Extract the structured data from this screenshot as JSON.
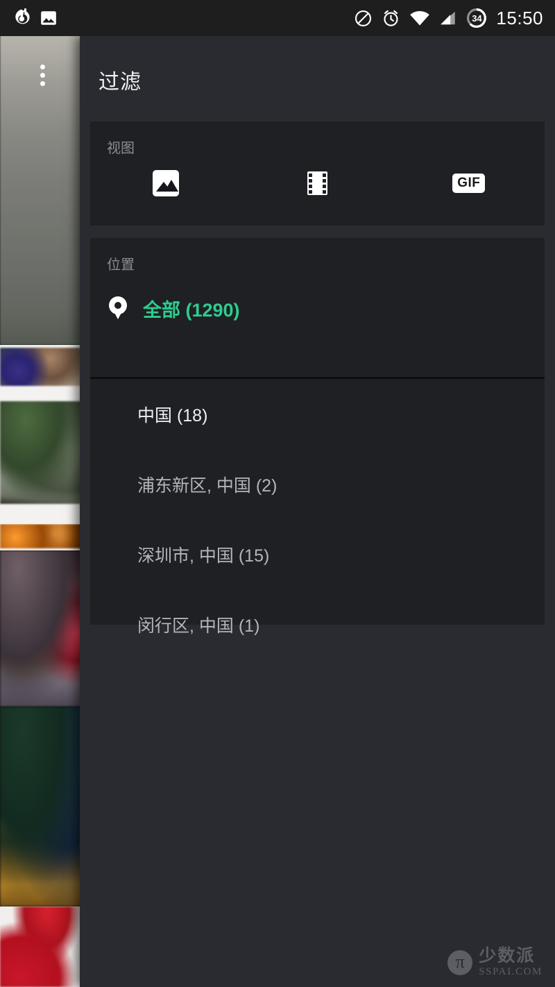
{
  "status_bar": {
    "time": "15:50",
    "battery_level": "34",
    "left_icons": [
      {
        "name": "netease-music-icon"
      },
      {
        "name": "gallery-notification-icon"
      }
    ],
    "right_icons": [
      {
        "name": "do-not-disturb-icon"
      },
      {
        "name": "alarm-icon"
      },
      {
        "name": "wifi-icon"
      },
      {
        "name": "cellular-signal-icon"
      },
      {
        "name": "battery-icon"
      }
    ]
  },
  "background": {
    "overflow_menu": "more-options-icon"
  },
  "drawer": {
    "title": "过滤",
    "view_card": {
      "label": "视图",
      "options": [
        {
          "icon": "image-icon",
          "id": "photos"
        },
        {
          "icon": "film-icon",
          "id": "videos"
        },
        {
          "icon": "gif-icon",
          "label": "GIF",
          "id": "gifs"
        }
      ]
    },
    "location_card": {
      "label": "位置",
      "selected": {
        "icon": "map-pin-icon",
        "label": "全部 (1290)",
        "color": "#2ecc8f"
      },
      "items": [
        {
          "label": "中国 (18)",
          "highlighted": true
        },
        {
          "label": "浦东新区, 中国 (2)",
          "highlighted": false
        },
        {
          "label": "深圳市, 中国 (15)",
          "highlighted": false
        },
        {
          "label": "闵行区, 中国 (1)",
          "highlighted": false
        }
      ]
    }
  },
  "watermark": {
    "logo": "pi-logo-icon",
    "symbol": "π",
    "name_cn": "少数派",
    "name_en": "SSPAI.COM"
  }
}
